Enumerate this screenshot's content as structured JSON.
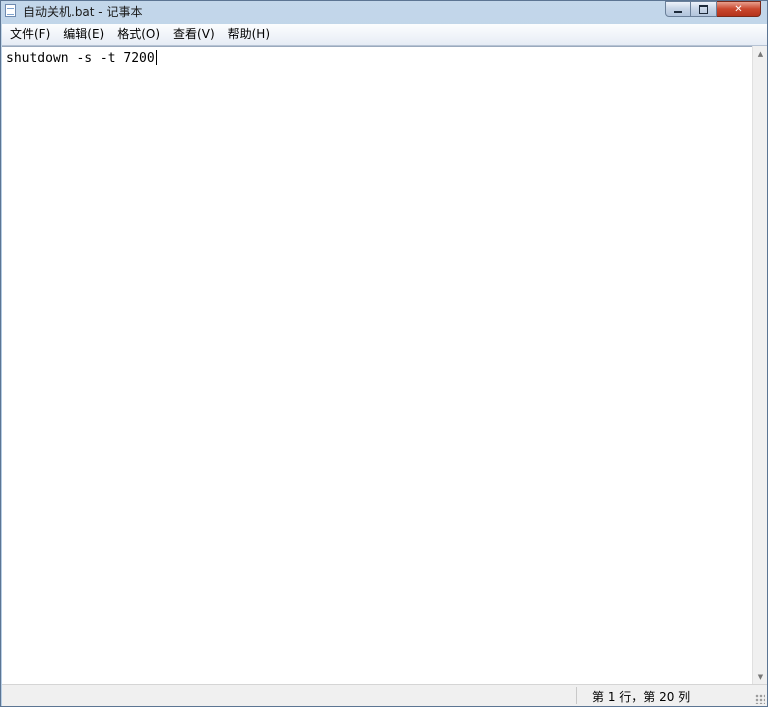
{
  "window": {
    "title": "自动关机.bat - 记事本"
  },
  "menu": {
    "items": [
      {
        "label": "文件(F)"
      },
      {
        "label": "编辑(E)"
      },
      {
        "label": "格式(O)"
      },
      {
        "label": "查看(V)"
      },
      {
        "label": "帮助(H)"
      }
    ]
  },
  "editor": {
    "content": "shutdown -s -t 7200"
  },
  "status": {
    "position": "第 1 行，第 20 列"
  },
  "colors": {
    "frame": "#b9cfe4",
    "close_button": "#c9472d",
    "editor_bg": "#ffffff"
  }
}
